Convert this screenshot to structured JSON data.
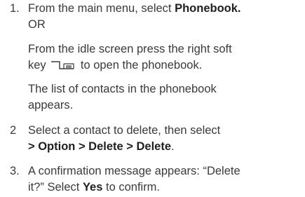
{
  "steps": [
    {
      "number": "1.",
      "lines": [
        {
          "pre": "From the main menu, select ",
          "bold": "Phonebook."
        },
        {
          "text": "OR"
        },
        {
          "text": "From the idle screen press the right soft"
        },
        {
          "pre": "key",
          "post": "to open the phonebook.",
          "icon": "right-soft-key-icon"
        },
        {
          "text": "The list of contacts in the phonebook"
        },
        {
          "text": "appears."
        }
      ]
    },
    {
      "number": "2",
      "lines": [
        {
          "text": "Select a contact to delete, then select"
        },
        {
          "bold": "> Option > Delete > Delete",
          "post": "."
        }
      ]
    },
    {
      "number": "3.",
      "lines": [
        {
          "text": "A confirmation message appears: “Delete"
        },
        {
          "pre": "it?” Select ",
          "bold": "Yes",
          "post": " to confirm."
        }
      ]
    }
  ]
}
